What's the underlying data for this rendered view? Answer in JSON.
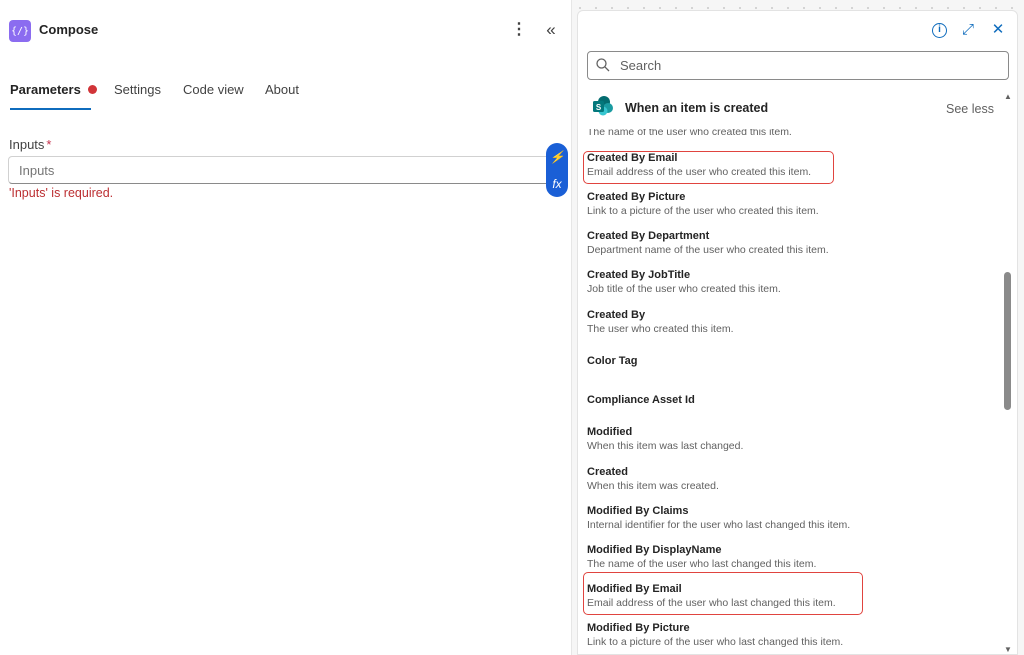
{
  "header": {
    "title": "Compose",
    "app_icon_glyph": "{/}",
    "more_icon": "more-vertical-icon",
    "collapse_icon": "double-chevron-left-icon"
  },
  "tabs": [
    {
      "label": "Parameters",
      "active": true,
      "has_error_dot": true
    },
    {
      "label": "Settings",
      "active": false
    },
    {
      "label": "Code view",
      "active": false
    },
    {
      "label": "About",
      "active": false
    }
  ],
  "inputs": {
    "label": "Inputs",
    "required_marker": "*",
    "placeholder": "Inputs",
    "error": "'Inputs' is required."
  },
  "float_bar": {
    "dynamic_content_glyph": "⚡",
    "expression_glyph": "fx"
  },
  "dynamic_panel": {
    "icons": [
      "info-icon",
      "expand-icon",
      "close-icon"
    ],
    "search": {
      "placeholder": "Search"
    },
    "section": {
      "icon": "sharepoint-icon",
      "title": "When an item is created",
      "toggle_label": "See less"
    },
    "items": [
      {
        "title": "",
        "description": "The name of the user who created this item."
      },
      {
        "title": "Created By Email",
        "description": "Email address of the user who created this item.",
        "highlighted": true
      },
      {
        "title": "Created By Picture",
        "description": "Link to a picture of the user who created this item."
      },
      {
        "title": "Created By Department",
        "description": "Department name of the user who created this item."
      },
      {
        "title": "Created By JobTitle",
        "description": "Job title of the user who created this item."
      },
      {
        "title": "Created By",
        "description": "The user who created this item."
      },
      {
        "title": "Color Tag",
        "description": ""
      },
      {
        "title": "Compliance Asset Id",
        "description": ""
      },
      {
        "title": "Modified",
        "description": "When this item was last changed."
      },
      {
        "title": "Created",
        "description": "When this item was created."
      },
      {
        "title": "Modified By Claims",
        "description": "Internal identifier for the user who last changed this item."
      },
      {
        "title": "Modified By DisplayName",
        "description": "The name of the user who last changed this item."
      },
      {
        "title": "Modified By Email",
        "description": "Email address of the user who last changed this item.",
        "highlighted": true
      },
      {
        "title": "Modified By Picture",
        "description": "Link to a picture of the user who last changed this item."
      }
    ]
  },
  "colors": {
    "accent": "#0f6cbd",
    "error": "#bc2f32",
    "highlight_border": "#e0443f",
    "app_icon": "#8b6cf0",
    "float_bar": "#1a5fd6"
  }
}
